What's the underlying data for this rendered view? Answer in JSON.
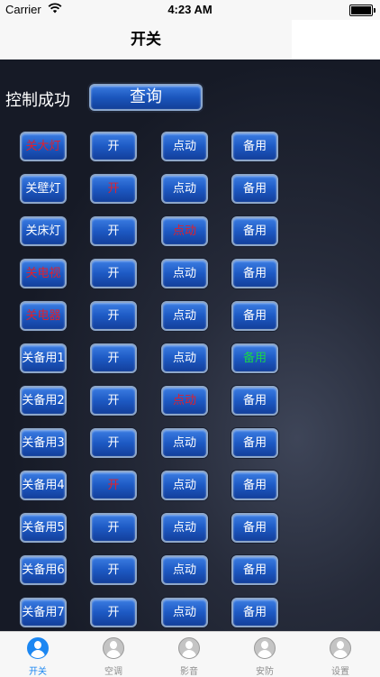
{
  "status_bar": {
    "carrier": "Carrier",
    "time": "4:23 AM"
  },
  "nav": {
    "title": "开关"
  },
  "main": {
    "status_text": "控制成功",
    "query_label": "查询",
    "rows": [
      {
        "b1": "关大灯",
        "b2": "开",
        "b3": "点动",
        "b4": "备用"
      },
      {
        "b1": "关壁灯",
        "b2": "开",
        "b3": "点动",
        "b4": "备用"
      },
      {
        "b1": "关床灯",
        "b2": "开",
        "b3": "点动",
        "b4": "备用"
      },
      {
        "b1": "关电视",
        "b2": "开",
        "b3": "点动",
        "b4": "备用"
      },
      {
        "b1": "关电器",
        "b2": "开",
        "b3": "点动",
        "b4": "备用"
      },
      {
        "b1": "关备用1",
        "b2": "开",
        "b3": "点动",
        "b4": "备用"
      },
      {
        "b1": "关备用2",
        "b2": "开",
        "b3": "点动",
        "b4": "备用"
      },
      {
        "b1": "关备用3",
        "b2": "开",
        "b3": "点动",
        "b4": "备用"
      },
      {
        "b1": "关备用4",
        "b2": "开",
        "b3": "点动",
        "b4": "备用"
      },
      {
        "b1": "关备用5",
        "b2": "开",
        "b3": "点动",
        "b4": "备用"
      },
      {
        "b1": "关备用6",
        "b2": "开",
        "b3": "点动",
        "b4": "备用"
      },
      {
        "b1": "关备用7",
        "b2": "开",
        "b3": "点动",
        "b4": "备用"
      }
    ]
  },
  "tabs": [
    {
      "label": "开关",
      "icon": "user-icon",
      "active": true
    },
    {
      "label": "空调",
      "icon": "user-icon",
      "active": false
    },
    {
      "label": "影音",
      "icon": "user-icon",
      "active": false
    },
    {
      "label": "安防",
      "icon": "user-icon",
      "active": false
    },
    {
      "label": "设置",
      "icon": "user-icon",
      "active": false
    }
  ],
  "colors": {
    "highlight_red": "#e0202c",
    "highlight_green": "#18d44a",
    "tab_active": "#1c87f2",
    "button_blue": "#1d59c3"
  }
}
